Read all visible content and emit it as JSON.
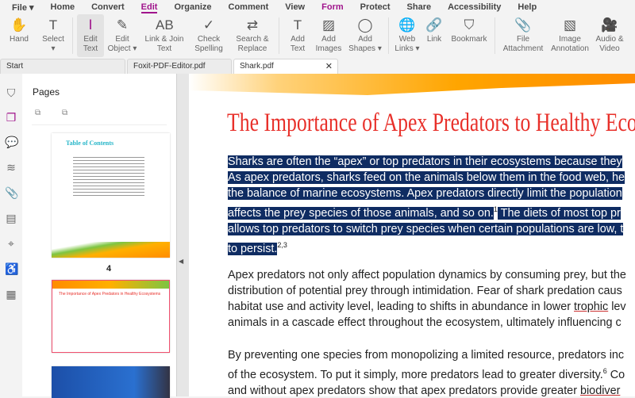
{
  "menu": [
    "File ▾",
    "Home",
    "Convert",
    "Edit",
    "Organize",
    "Comment",
    "View",
    "Form",
    "Protect",
    "Share",
    "Accessibility",
    "Help"
  ],
  "ribbon": [
    {
      "l1": "Hand",
      "l2": "",
      "icon": "hand-icon",
      "g": "✋"
    },
    {
      "l1": "Select",
      "l2": "▾",
      "icon": "select-icon",
      "g": "T"
    },
    {
      "l1": "Edit",
      "l2": "Text",
      "icon": "edit-text-icon",
      "g": "Ⅰ"
    },
    {
      "l1": "Edit",
      "l2": "Object ▾",
      "icon": "edit-object-icon",
      "g": "✎"
    },
    {
      "l1": "Link & Join",
      "l2": "Text",
      "icon": "link-join-icon",
      "g": "AB"
    },
    {
      "l1": "Check",
      "l2": "Spelling",
      "icon": "spell-check-icon",
      "g": "✓"
    },
    {
      "l1": "Search &",
      "l2": "Replace",
      "icon": "search-replace-icon",
      "g": "⇄"
    },
    {
      "l1": "Add",
      "l2": "Text",
      "icon": "add-text-icon",
      "g": "T"
    },
    {
      "l1": "Add",
      "l2": "Images",
      "icon": "add-image-icon",
      "g": "▨"
    },
    {
      "l1": "Add",
      "l2": "Shapes ▾",
      "icon": "add-shapes-icon",
      "g": "◯"
    },
    {
      "l1": "Web",
      "l2": "Links ▾",
      "icon": "web-links-icon",
      "g": "🌐"
    },
    {
      "l1": "Link",
      "l2": "",
      "icon": "link-icon",
      "g": "🔗"
    },
    {
      "l1": "Bookmark",
      "l2": "",
      "icon": "bookmark-icon",
      "g": "⛉"
    },
    {
      "l1": "File",
      "l2": "Attachment",
      "icon": "file-attachment-icon",
      "g": "📎"
    },
    {
      "l1": "Image",
      "l2": "Annotation",
      "icon": "image-annotation-icon",
      "g": "▧"
    },
    {
      "l1": "Audio &",
      "l2": "Video",
      "icon": "audio-video-icon",
      "g": "🎥"
    }
  ],
  "tabs": [
    "Start",
    "Foxit-PDF-Editor.pdf",
    "Shark.pdf"
  ],
  "panel": {
    "title": "Pages",
    "page_label": "4",
    "toc_title": "Table of Contents",
    "thumb2_title": "The Importance of Apex Predators in Healthy Ecosystems"
  },
  "doc": {
    "title": "The Importance of Apex Predators to Healthy Ecosystems",
    "p1": [
      "Sharks are often the “apex” or top predators in their ecosystems because they",
      "As apex predators, sharks feed on the animals below them in the food web, he",
      "the balance of marine ecosystems. Apex predators directly limit the population",
      "affects the prey species of those animals, and so on.",
      "1",
      " The diets of most top pr",
      "allows top predators to switch prey species when certain populations are low, t",
      "to persist.",
      "2,3"
    ],
    "p2": [
      "Apex predators not only affect population dynamics by consuming prey, but the",
      "distribution of potential prey through intimidation. Fear of shark predation caus",
      "habitat use and activity level, leading to shifts in abundance in lower ",
      "trophic",
      " lev",
      "animals in a cascade effect throughout the ecosystem, ultimately influencing c"
    ],
    "p3": [
      "By preventing one species from monopolizing a limited resource, predators inc",
      "of the ecosystem. To put it simply, more predators lead to greater diversity.",
      "6",
      " Co",
      "and without apex predators show that apex predators provide greater ",
      "biodiver"
    ]
  },
  "colors": {
    "accent": "#a0148c",
    "title": "#e8302a",
    "selection": "#0f2c62"
  }
}
